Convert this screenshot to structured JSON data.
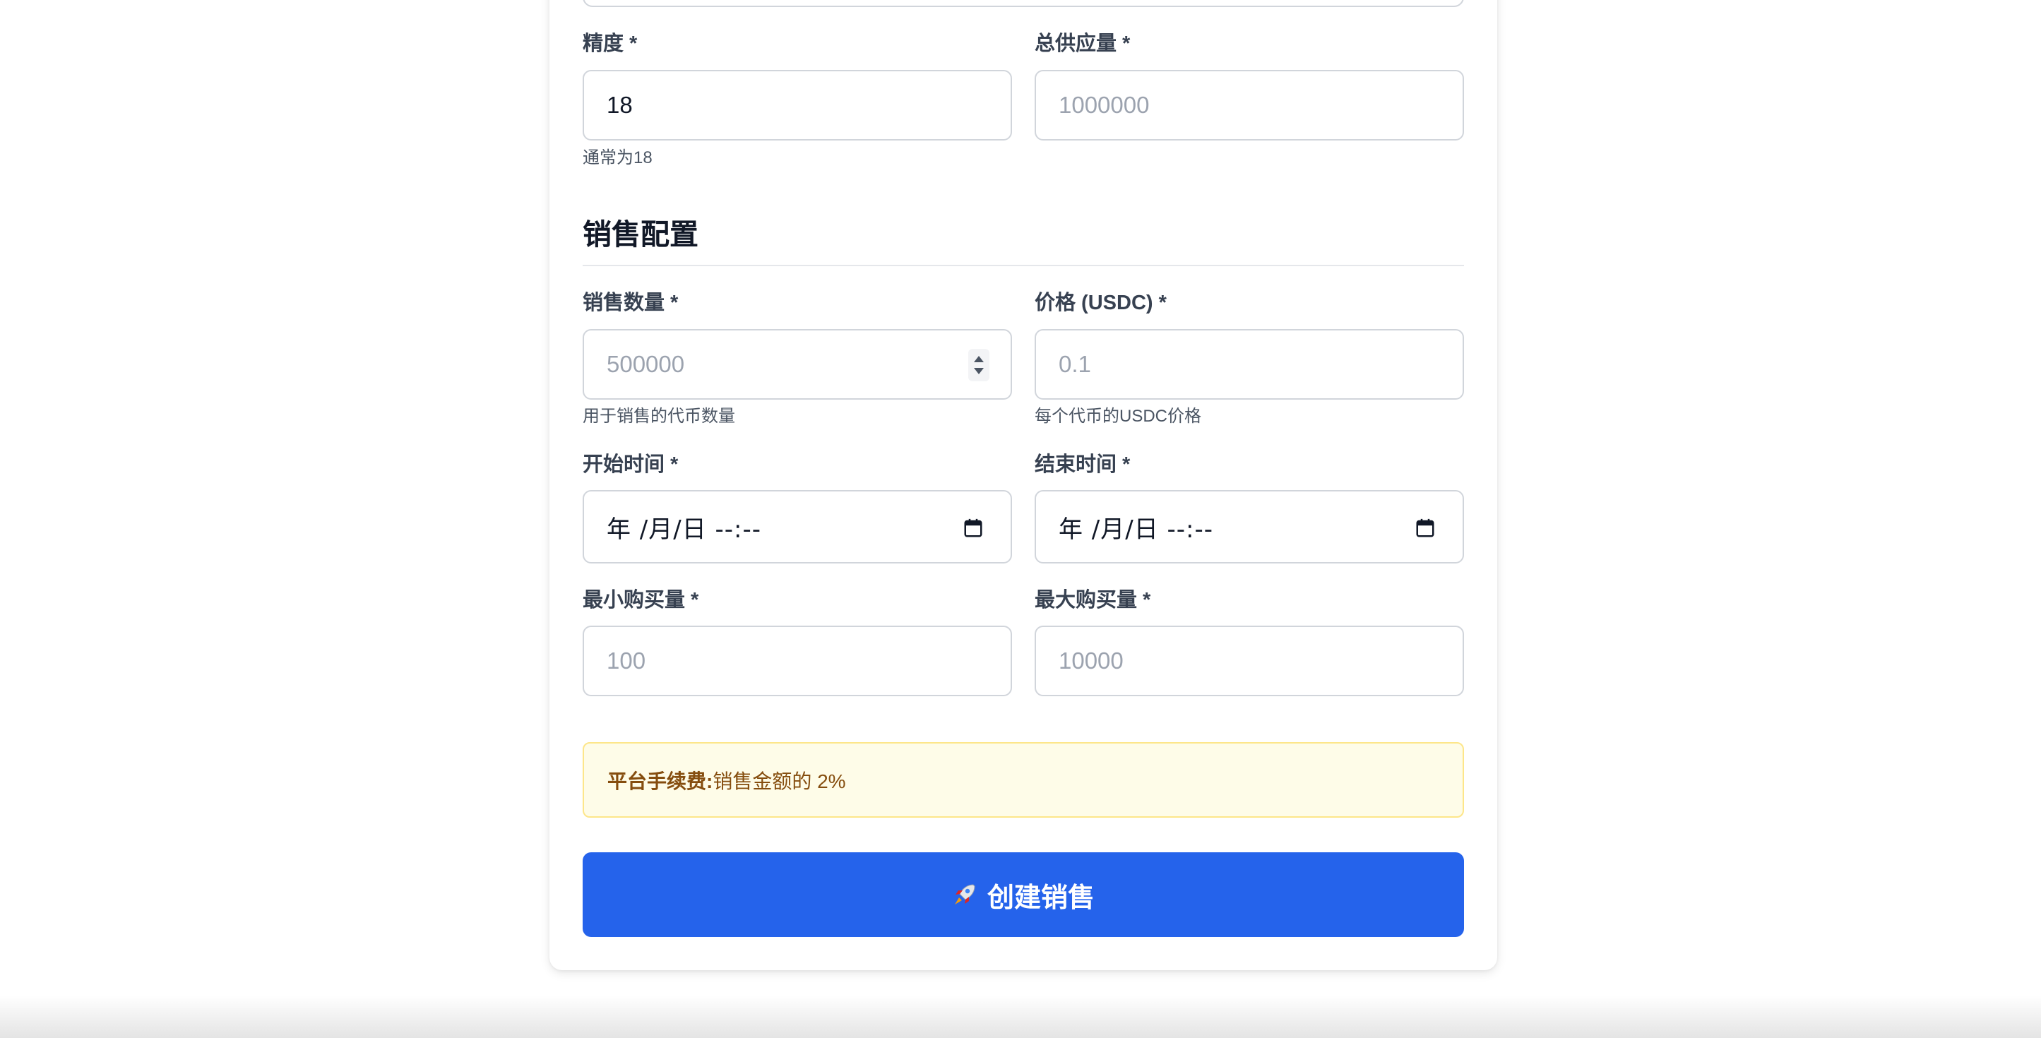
{
  "token": {
    "decimals_label": "精度 *",
    "decimals_value": "18",
    "decimals_hint": "通常为18",
    "supply_label": "总供应量 *",
    "supply_placeholder": "1000000"
  },
  "sale": {
    "section_title": "销售配置",
    "amount_label": "销售数量 *",
    "amount_placeholder": "500000",
    "amount_hint": "用于销售的代币数量",
    "price_label": "价格 (USDC) *",
    "price_placeholder": "0.1",
    "price_hint": "每个代币的USDC价格",
    "start_label": "开始时间 *",
    "start_value": "年 /月/日 --:--",
    "end_label": "结束时间 *",
    "end_value": "年 /月/日 --:--",
    "min_label": "最小购买量 *",
    "min_placeholder": "100",
    "max_label": "最大购买量 *",
    "max_placeholder": "10000"
  },
  "fee": {
    "label": "平台手续费:",
    "text": "销售金额的 2%"
  },
  "submit": {
    "label": "创建销售",
    "icon": "rocket-icon"
  },
  "colors": {
    "primary": "#2563eb",
    "notice_bg": "#fefce8",
    "notice_border": "#fde68a",
    "notice_text": "#854d0e"
  }
}
